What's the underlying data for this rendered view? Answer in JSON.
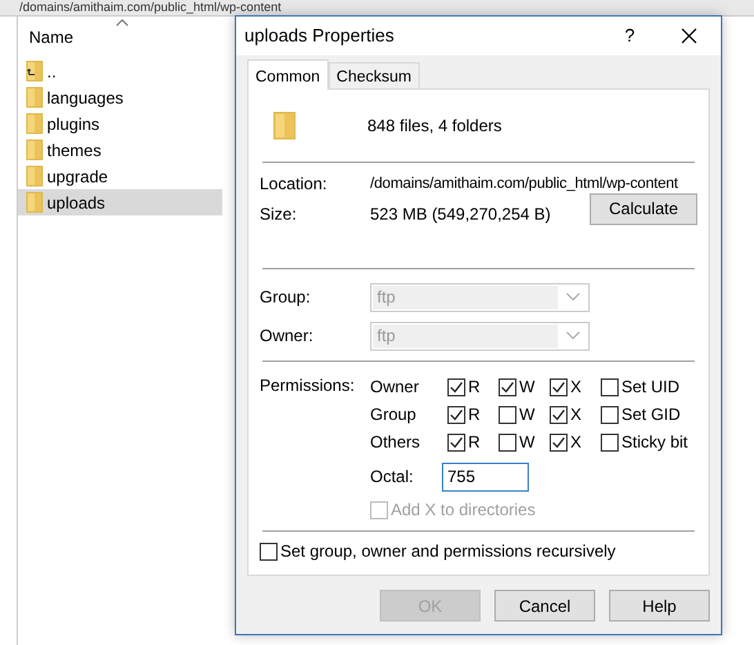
{
  "path_bar": {
    "text": "/domains/amithaim.com/public_html/wp-content"
  },
  "file_list": {
    "header": "Name",
    "items": [
      {
        "name": "..",
        "kind": "parent",
        "selected": false
      },
      {
        "name": "languages",
        "kind": "folder",
        "selected": false
      },
      {
        "name": "plugins",
        "kind": "folder",
        "selected": false
      },
      {
        "name": "themes",
        "kind": "folder",
        "selected": false
      },
      {
        "name": "upgrade",
        "kind": "folder",
        "selected": false
      },
      {
        "name": "uploads",
        "kind": "folder",
        "selected": true
      }
    ]
  },
  "dialog": {
    "title": "uploads Properties",
    "help": "?",
    "tabs": [
      {
        "label": "Common",
        "selected": true
      },
      {
        "label": "Checksum",
        "selected": false
      }
    ],
    "summary": "848 files, 4 folders",
    "location": {
      "label": "Location:",
      "value": "/domains/amithaim.com/public_html/wp-content"
    },
    "size": {
      "label": "Size:",
      "value": "523 MB (549,270,254 B)"
    },
    "calculate": "Calculate",
    "selects": [
      {
        "label": "Group:",
        "value": "ftp",
        "disabled": true
      },
      {
        "label": "Owner:",
        "value": "ftp",
        "disabled": true
      }
    ],
    "permissions_label": "Permissions:",
    "permissions": [
      {
        "label": "Owner",
        "bits": [
          {
            "label": "R",
            "checked": true
          },
          {
            "label": "W",
            "checked": true
          },
          {
            "label": "X",
            "checked": true
          },
          {
            "label": "Set UID",
            "checked": false
          }
        ]
      },
      {
        "label": "Group",
        "bits": [
          {
            "label": "R",
            "checked": true
          },
          {
            "label": "W",
            "checked": false
          },
          {
            "label": "X",
            "checked": true
          },
          {
            "label": "Set GID",
            "checked": false
          }
        ]
      },
      {
        "label": "Others",
        "bits": [
          {
            "label": "R",
            "checked": true
          },
          {
            "label": "W",
            "checked": false
          },
          {
            "label": "X",
            "checked": true
          },
          {
            "label": "Sticky bit",
            "checked": false
          }
        ]
      }
    ],
    "octal": {
      "label": "Octal:",
      "value": "755"
    },
    "add_x": {
      "label": "Add X to directories",
      "checked": false,
      "disabled": true
    },
    "recursive": {
      "label": "Set group, owner and permissions recursively",
      "checked": false
    },
    "buttons": [
      {
        "label": "OK",
        "disabled": true
      },
      {
        "label": "Cancel",
        "disabled": false
      },
      {
        "label": "Help",
        "disabled": false
      }
    ]
  }
}
